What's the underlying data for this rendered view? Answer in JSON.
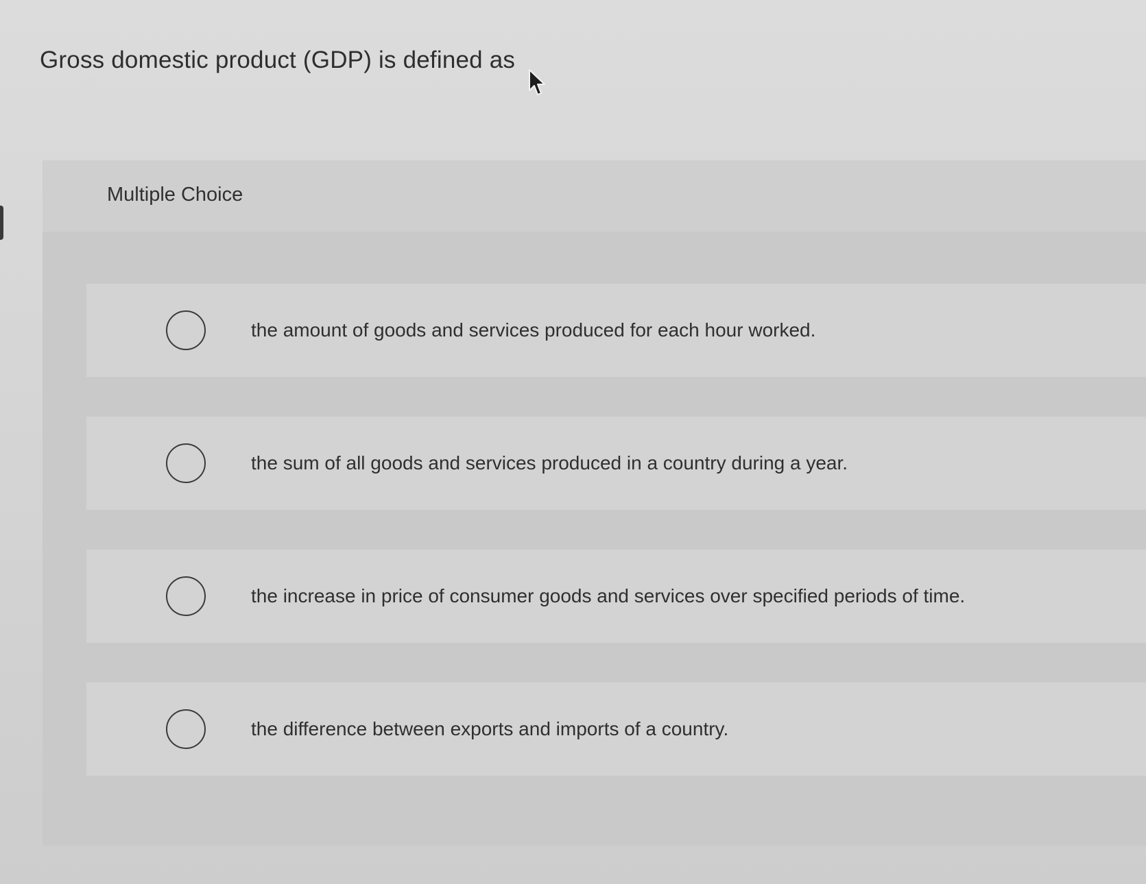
{
  "question": {
    "text": "Gross domestic product (GDP) is defined as"
  },
  "panel": {
    "title": "Multiple Choice"
  },
  "options": [
    {
      "label": "the amount of goods and services produced for each hour worked.",
      "selected": false
    },
    {
      "label": "the sum of all goods and services produced in a country during a year.",
      "selected": false
    },
    {
      "label": "the increase in price of consumer goods and services over specified periods of time.",
      "selected": false
    },
    {
      "label": "the difference between exports and imports of a country.",
      "selected": false
    }
  ],
  "icons": {
    "cursor": "mouse-pointer-icon",
    "radio": "radio-button-icon"
  }
}
